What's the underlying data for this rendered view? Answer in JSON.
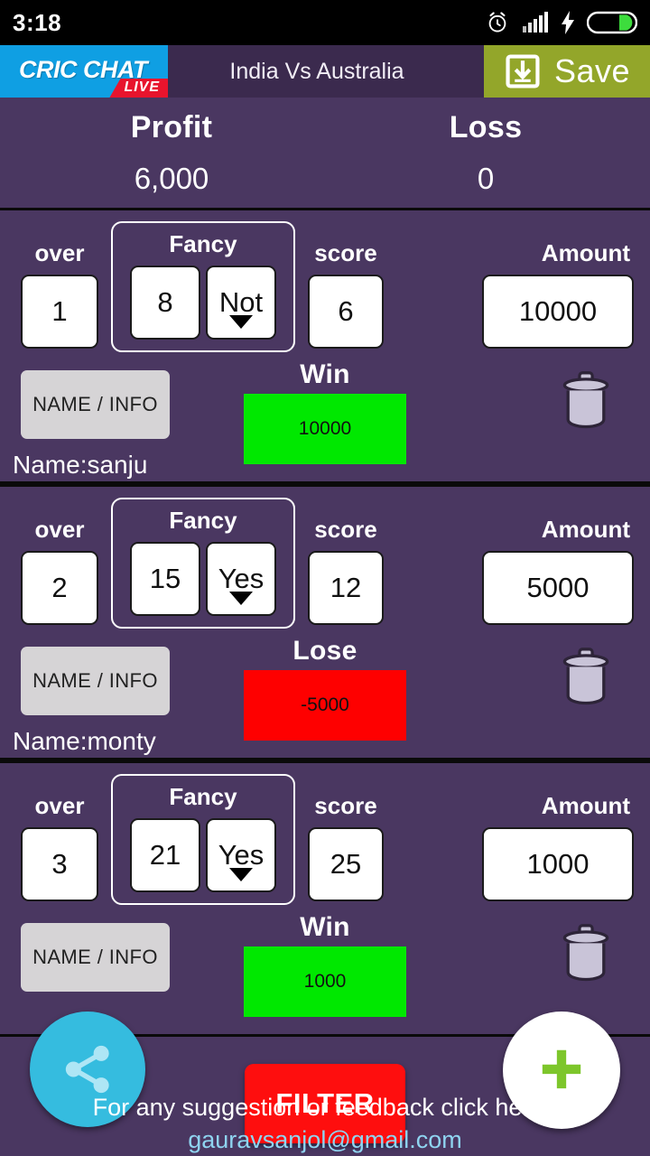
{
  "statusbar": {
    "time": "3:18",
    "icons": [
      "alarm-icon",
      "signal-icon",
      "charging-icon",
      "battery-icon"
    ]
  },
  "header": {
    "logo_text": "CRIC CHAT",
    "logo_badge": "LIVE",
    "title": "India Vs Australia",
    "save_label": "Save",
    "save_icon": "save-icon"
  },
  "summary": {
    "profit_label": "Profit",
    "profit_value": "6,000",
    "loss_label": "Loss",
    "loss_value": "0"
  },
  "labels": {
    "over": "over",
    "fancy": "Fancy",
    "score": "score",
    "amount": "Amount",
    "name_info": "NAME / INFO"
  },
  "bets": [
    {
      "over": "1",
      "fancy_runs": "8",
      "fancy_choice": "Not",
      "score": "6",
      "amount": "10000",
      "result_label": "Win",
      "result_value": "10000",
      "result_type": "win",
      "name": "Name:sanju"
    },
    {
      "over": "2",
      "fancy_runs": "15",
      "fancy_choice": "Yes",
      "score": "12",
      "amount": "5000",
      "result_label": "Lose",
      "result_value": "-5000",
      "result_type": "lose",
      "name": "Name:monty"
    },
    {
      "over": "3",
      "fancy_runs": "21",
      "fancy_choice": "Yes",
      "score": "25",
      "amount": "1000",
      "result_label": "Win",
      "result_value": "1000",
      "result_type": "win",
      "name": ""
    }
  ],
  "actions": {
    "share_icon": "share-icon",
    "add_icon": "plus-icon",
    "filter_label": "FILTER",
    "delete_icon": "trash-icon"
  },
  "footer": {
    "line1": "For any suggestion or feedback click here :",
    "line2": "gauravsanjol@gmail.com"
  },
  "colors": {
    "background": "#4a3761",
    "header": "#3b2a4e",
    "logo": "#0f9fe3",
    "live_badge": "#e8142d",
    "save": "#93a62a",
    "win": "#00e800",
    "lose": "#fe0000",
    "share_fab": "#35bcdf",
    "filter": "#fe0e0e",
    "plus": "#7dc62b"
  }
}
